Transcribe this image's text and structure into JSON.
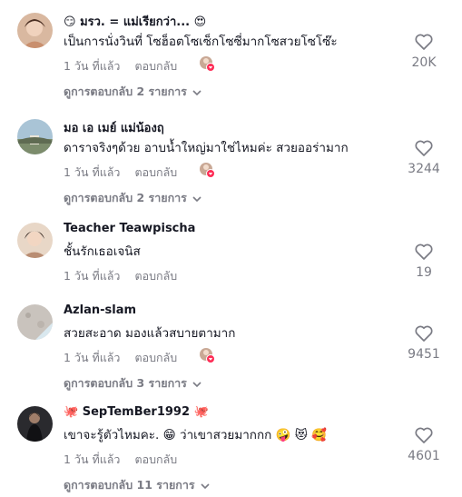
{
  "comments": [
    {
      "username": "😏 มรว. = แม่เรียกว่า... 😍",
      "text": "เป็นการนั่งวินที่ โซฮ็อตโซเซ็กโซซี่มากโซสวยโซโซ๊ะ",
      "time": "1 วัน ที่แล้ว",
      "reply_label": "ตอบกลับ",
      "likes": "20K",
      "view_replies": "ดูการตอบกลับ 2 รายการ",
      "creator_liked": true
    },
    {
      "username": "มอ เอ เมย์ แม่น้องฤ",
      "text": "ดาราจริงๆด้วย อาบน้ำใหญ่มาใช่ไหมค่ะ สวยออร่ามาก",
      "time": "1 วัน ที่แล้ว",
      "reply_label": "ตอบกลับ",
      "likes": "3244",
      "view_replies": "ดูการตอบกลับ 2 รายการ",
      "creator_liked": true
    },
    {
      "username": "Teacher Teawpischa",
      "text": "ชั้นรักเธอเจนิส",
      "time": "1 วัน ที่แล้ว",
      "reply_label": "ตอบกลับ",
      "likes": "19",
      "view_replies": "",
      "creator_liked": false
    },
    {
      "username": "Azlan-slam",
      "text": "สวยสะอาด มองแล้วสบายตามาก",
      "time": "1 วัน ที่แล้ว",
      "reply_label": "ตอบกลับ",
      "likes": "9451",
      "view_replies": "ดูการตอบกลับ 3 รายการ",
      "creator_liked": true
    },
    {
      "username": "🐙 SepTemBer1992 🐙",
      "text": "เขาจะรู้ตัวไหมคะ. 😁 ว่าเขาสวยมากกก 🤪 😻 🥰",
      "time": "1 วัน ที่แล้ว",
      "reply_label": "ตอบกลับ",
      "likes": "4601",
      "view_replies": "ดูการตอบกลับ 11 รายการ",
      "creator_liked": false
    }
  ],
  "colors": {
    "text": "#161823",
    "muted": "#7a7b84",
    "accent": "#fe2c55"
  }
}
